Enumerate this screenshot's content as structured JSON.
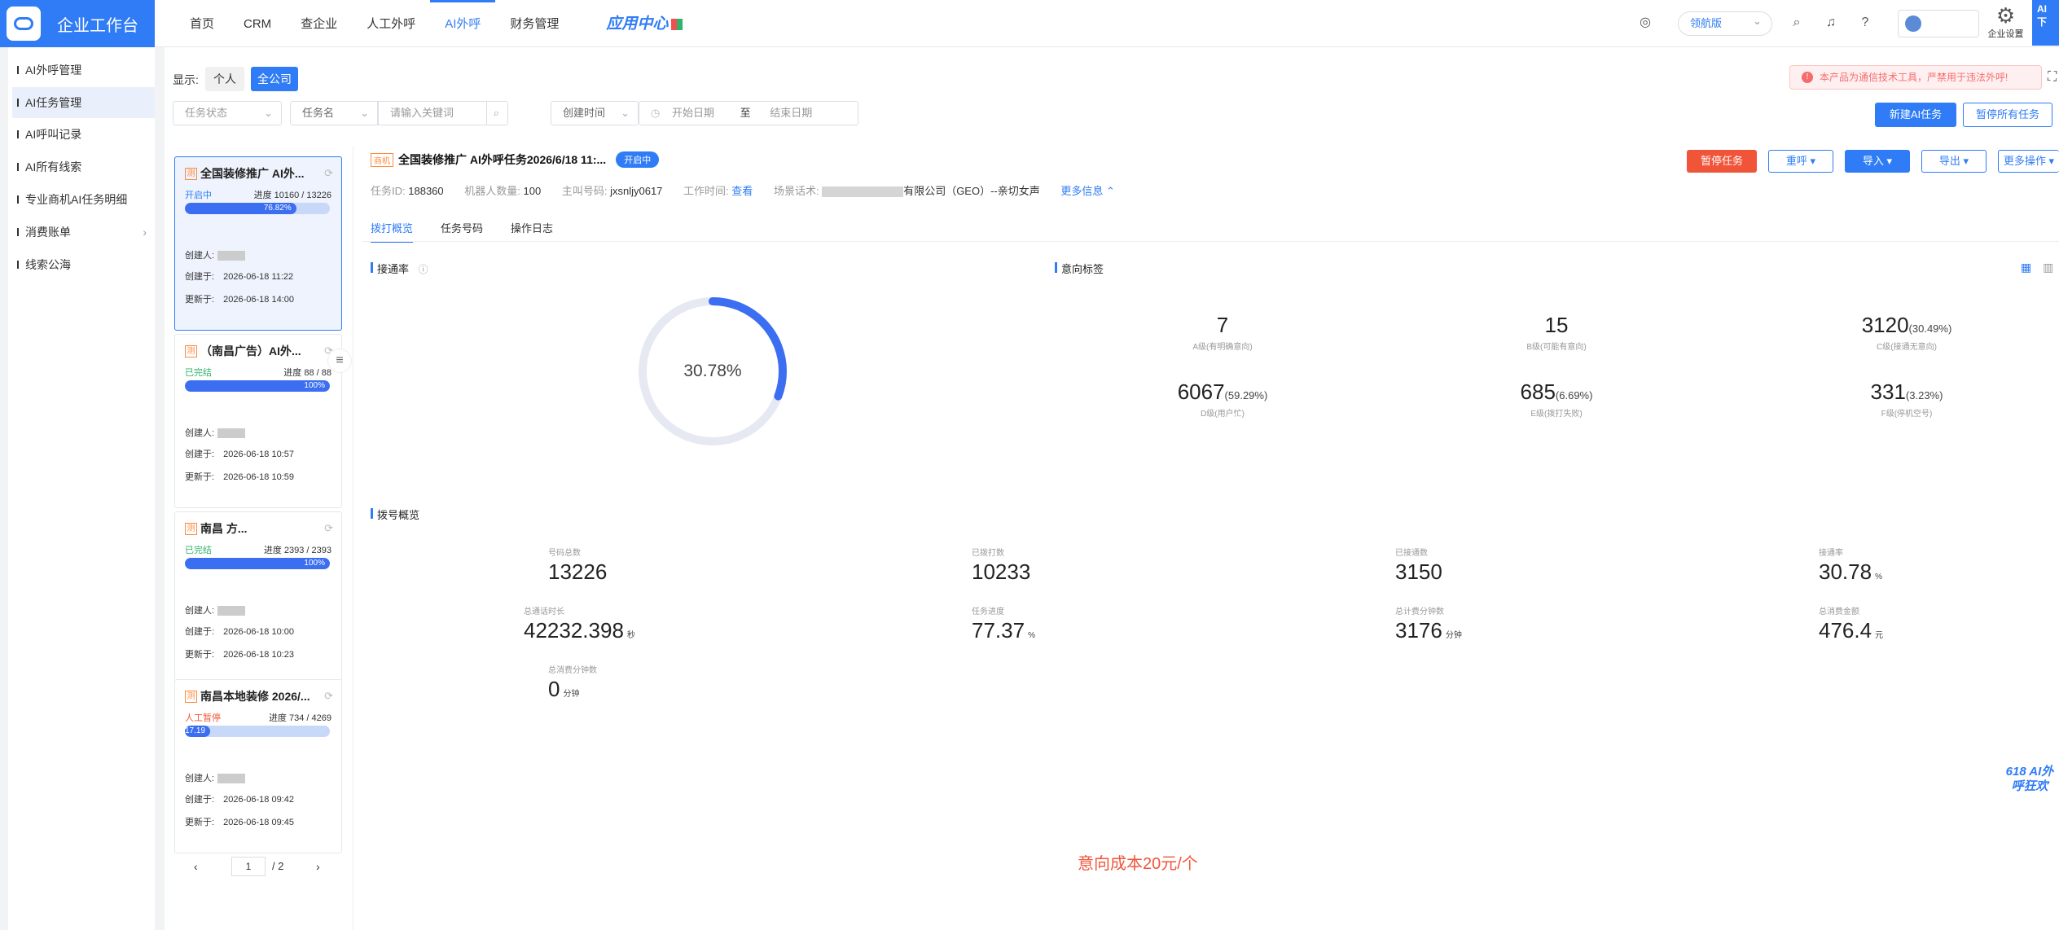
{
  "brand": {
    "title": "企业工作台"
  },
  "nav": {
    "items": [
      "首页",
      "CRM",
      "查企业",
      "人工外呼",
      "AI外呼",
      "财务管理"
    ],
    "app_center": "应用中心"
  },
  "topright": {
    "version": "领航版",
    "settings": "企业设置",
    "blue_tab": "AI 下"
  },
  "sidebar": {
    "items": [
      "AI外呼管理",
      "AI任务管理",
      "AI呼叫记录",
      "AI所有线索",
      "专业商机AI任务明细",
      "消费账单",
      "线索公海"
    ]
  },
  "filter": {
    "show_label": "显示:",
    "personal": "个人",
    "company": "全公司",
    "notice": "本产品为通信技术工具，严禁用于违法外呼!",
    "task_status": "任务状态",
    "task_name": "任务名",
    "keyword_placeholder": "请输入关键词",
    "create_time": "创建时间",
    "start_date": "开始日期",
    "to": "至",
    "end_date": "结束日期",
    "new_task": "新建AI任务",
    "pause_all": "暂停所有任务"
  },
  "tasks": [
    {
      "tag": "测",
      "name": "全国装修推广 AI外...",
      "status": "开启中",
      "status_color": "#2f7cf6",
      "progress_label": "进度 10160 / 13226",
      "progress": 76.82,
      "progress_text": "76.82%",
      "creator": "创建人:",
      "created": "创建于:",
      "created_val": "2026-06-18 11:22",
      "updated": "更新于:",
      "updated_val": "2026-06-18 14:00"
    },
    {
      "tag": "测",
      "name": "（南昌广告）AI外...",
      "status": "已完结",
      "status_color": "#2fb36b",
      "progress_label": "进度 88 / 88",
      "progress": 100,
      "progress_text": "100%",
      "creator": "创建人:",
      "created": "创建于:",
      "created_val": "2026-06-18 10:57",
      "updated": "更新于:",
      "updated_val": "2026-06-18 10:59"
    },
    {
      "tag": "测",
      "name": "南昌               方...",
      "status": "已完结",
      "status_color": "#2fb36b",
      "progress_label": "进度 2393 / 2393",
      "progress": 100,
      "progress_text": "100%",
      "creator": "创建人:",
      "created": "创建于:",
      "created_val": "2026-06-18 10:00",
      "updated": "更新于:",
      "updated_val": "2026-06-18 10:23"
    },
    {
      "tag": "测",
      "name": "南昌本地装修 2026/...",
      "status": "人工暂停",
      "status_color": "#f0553a",
      "progress_label": "进度 734 / 4269",
      "progress": 17.19,
      "progress_text": "17.19",
      "creator": "创建人:",
      "created": "创建于:",
      "created_val": "2026-06-18 09:42",
      "updated": "更新于:",
      "updated_val": "2026-06-18 09:45"
    }
  ],
  "pager": {
    "prev": "‹",
    "current": "1",
    "total": "/ 2",
    "next": "›"
  },
  "detail": {
    "tag": "商机",
    "title": "全国装修推广 AI外呼任务2026/6/18 11:...",
    "status": "开启中",
    "actions": {
      "pause": "暂停任务",
      "recall": "重呼",
      "import": "导入",
      "export": "导出",
      "more": "更多操作"
    },
    "info": {
      "task_id_label": "任务ID:",
      "task_id": "188360",
      "robots_label": "机器人数量:",
      "robots": "100",
      "caller_label": "主叫号码:",
      "caller": "jxsnljy0617",
      "worktime_label": "工作时间:",
      "worktime": "查看",
      "script_label": "场景话术:",
      "script": "有限公司（GEO）--亲切女声",
      "more_info": "更多信息 ⌃"
    },
    "tabs": [
      "拨打概览",
      "任务号码",
      "操作日志"
    ],
    "connect_title": "接通率",
    "connect_rate": "30.78%",
    "connect_value": 30.78,
    "intent_title": "意向标签",
    "intents": [
      {
        "value": "7",
        "pct": "",
        "label": "A级(有明确意向)"
      },
      {
        "value": "15",
        "pct": "",
        "label": "B级(可能有意向)"
      },
      {
        "value": "3120",
        "pct": "(30.49%)",
        "label": "C级(接通无意向)"
      },
      {
        "value": "6067",
        "pct": "(59.29%)",
        "label": "D级(用户忙)"
      },
      {
        "value": "685",
        "pct": "(6.69%)",
        "label": "E级(拨打失败)"
      },
      {
        "value": "331",
        "pct": "(3.23%)",
        "label": "F级(停机空号)"
      }
    ],
    "dial_title": "拨号概览",
    "dial_stats": [
      {
        "label": "号码总数",
        "value": "13226",
        "unit": ""
      },
      {
        "label": "已拨打数",
        "value": "10233",
        "unit": ""
      },
      {
        "label": "已接通数",
        "value": "3150",
        "unit": ""
      },
      {
        "label": "接通率",
        "value": "30.78",
        "unit": "%"
      },
      {
        "label": "总通话时长",
        "value": "42232.398",
        "unit": "秒"
      },
      {
        "label": "任务进度",
        "value": "77.37",
        "unit": "%"
      },
      {
        "label": "总计费分钟数",
        "value": "3176",
        "unit": "分钟"
      },
      {
        "label": "总消费金额",
        "value": "476.4",
        "unit": "元"
      },
      {
        "label": "总消费分钟数",
        "value": "0",
        "unit": "分钟"
      }
    ],
    "cost_note": "意向成本20元/个",
    "float_logo": "618 AI外呼狂欢"
  }
}
